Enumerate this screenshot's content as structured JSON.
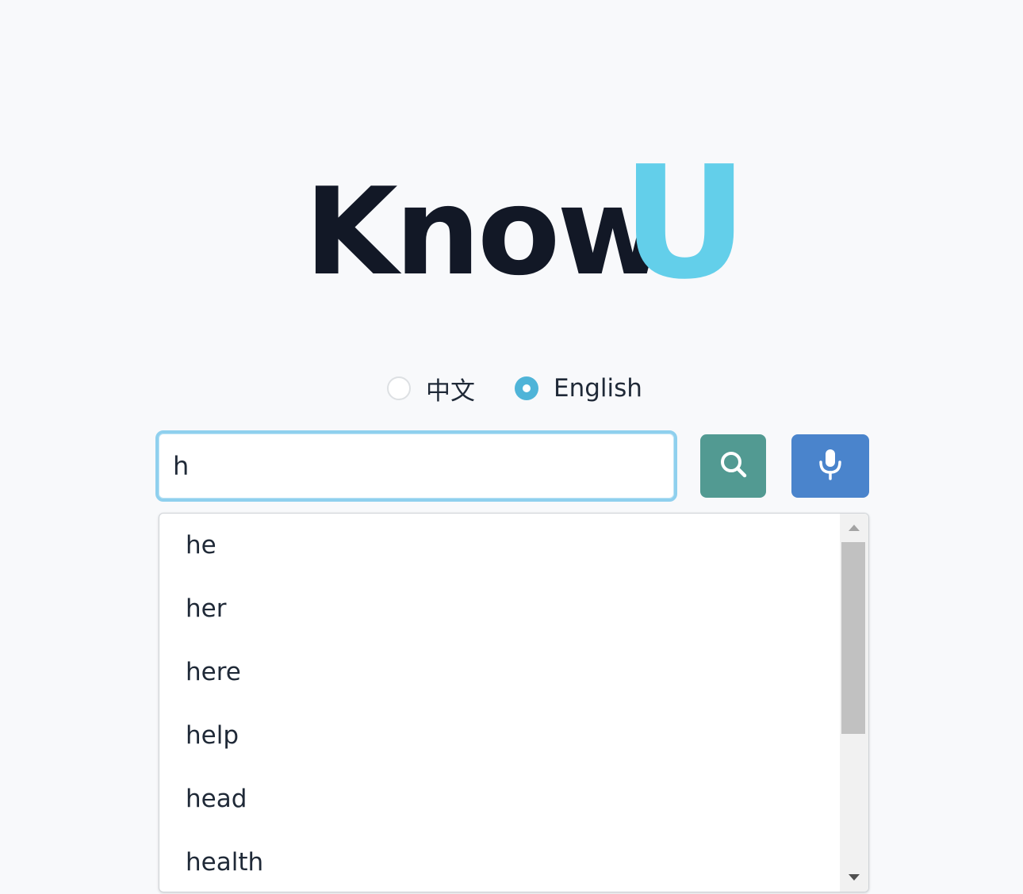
{
  "logo": {
    "part1": "Know",
    "part2": "U",
    "colors": {
      "part1": "#121826",
      "part2": "#63cfea"
    }
  },
  "language": {
    "options": [
      {
        "label": "中文",
        "selected": false
      },
      {
        "label": "English",
        "selected": true
      }
    ]
  },
  "search": {
    "value": "h"
  },
  "buttons": {
    "search_icon": "search-icon",
    "mic_icon": "microphone-icon",
    "colors": {
      "search": "#529a92",
      "mic": "#4a84cc"
    }
  },
  "suggestions": {
    "items": [
      "he",
      "her",
      "here",
      "help",
      "head",
      "health"
    ]
  },
  "colors": {
    "background": "#f8f9fb",
    "input_focus_border": "#8fd0ee",
    "radio_selected": "#4fb4d8"
  }
}
